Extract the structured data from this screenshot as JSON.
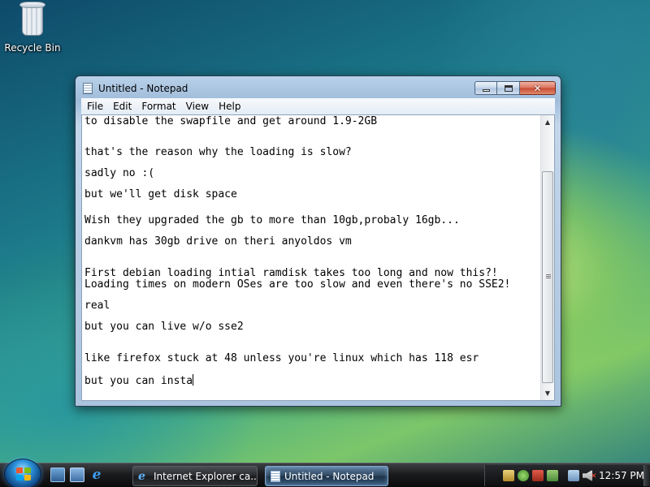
{
  "desktop": {
    "icons": [
      {
        "label": "Recycle Bin",
        "icon": "recycle-bin-icon"
      }
    ]
  },
  "window": {
    "title": "Untitled - Notepad",
    "buttons": {
      "minimize": "minimize",
      "maximize": "maximize",
      "close": "✕"
    },
    "menu": [
      "File",
      "Edit",
      "Format",
      "View",
      "Help"
    ],
    "text_lines": [
      "to disable the swapfile and get around 1.9-2GB",
      "that's the reason why the loading is slow?",
      "sadly no :(",
      "but we'll get disk space",
      "Wish they upgraded the gb to more than 10gb,probaly 16gb...",
      "dankvm has 30gb drive on theri anyoldos vm",
      "First debian loading intial ramdisk takes too long and now this?!",
      "Loading times on modern OSes are too slow and even there's no SSE2!",
      "real",
      "but you can live w/o sse2",
      "like firefox stuck at 48 unless you're linux which has 118 esr",
      "but you can insta"
    ]
  },
  "taskbar": {
    "start_icon": "windows-orb-icon",
    "quick_launch": [
      "show-desktop-icon",
      "switch-windows-icon",
      "internet-explorer-icon"
    ],
    "tasks": [
      {
        "label": "Internet Explorer ca...",
        "icon": "internet-explorer-icon",
        "active": false
      },
      {
        "label": "Untitled - Notepad",
        "icon": "notepad-icon",
        "active": true
      }
    ],
    "tray_icons": [
      "tray-app-icon",
      "tray-security-icon",
      "tray-alert-icon",
      "tray-update-icon",
      "network-icon",
      "volume-muted-icon"
    ],
    "clock": "12:57 PM"
  },
  "colors": {
    "accent": "#9fbcd9",
    "taskbar": "#1b1c1e",
    "close_button": "#c84a32"
  }
}
